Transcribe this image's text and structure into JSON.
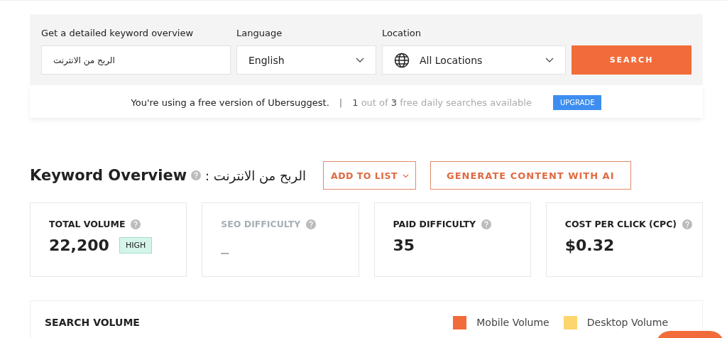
{
  "search_form": {
    "keyword": {
      "label": "Get a detailed keyword overview",
      "value": "الربح من الانترنت"
    },
    "language": {
      "label": "Language",
      "value": "English"
    },
    "location": {
      "label": "Location",
      "value": "All Locations"
    },
    "button": "SEARCH"
  },
  "banner": {
    "message": "You're using a free version of Ubersuggest.",
    "separator": "|",
    "used": "1",
    "out_of": "out of",
    "total": "3",
    "rest": "free daily searches available",
    "button": "UPGRADE"
  },
  "overview": {
    "title": "Keyword Overview",
    "keyword": ": الربح من الانترنت",
    "buttons": [
      {
        "label": "ADD TO LIST",
        "kind": "dropdown"
      },
      {
        "label": "GENERATE CONTENT WITH AI",
        "kind": "plain"
      }
    ]
  },
  "metrics": [
    {
      "label": "TOTAL VOLUME",
      "value": "22,200",
      "badge": "HIGH",
      "disabled": false
    },
    {
      "label": "SEO DIFFICULTY",
      "value": "_",
      "disabled": true
    },
    {
      "label": "PAID DIFFICULTY",
      "value": "35",
      "disabled": false
    },
    {
      "label": "COST PER CLICK (CPC)",
      "value": "$0.32",
      "disabled": false
    }
  ],
  "search_volume": {
    "title": "SEARCH VOLUME",
    "legend": [
      {
        "name": "Mobile Volume",
        "color": "#f26b3a"
      },
      {
        "name": "Desktop Volume",
        "color": "#fdd56f"
      }
    ]
  }
}
